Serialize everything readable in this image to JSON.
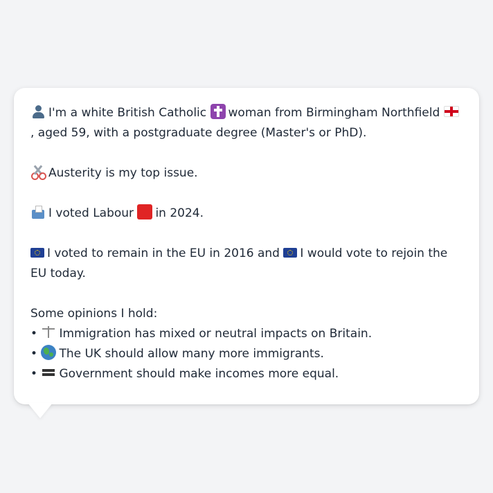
{
  "profile": {
    "intro_a": "I'm a white British Catholic",
    "intro_b": "woman from Birmingham Northfield",
    "intro_c": ", aged 59, with a postgraduate degree (Master's or PhD).",
    "top_issue": "Austerity is my top issue.",
    "vote_a": "I voted Labour",
    "vote_b": "in 2024.",
    "eu_a": "I voted to remain in the EU in 2016 and",
    "eu_b": "I would vote to rejoin the EU today."
  },
  "opinions": {
    "title": "Some opinions I hold:",
    "bullet": "•",
    "items": [
      {
        "icon": "scales-icon",
        "text": "Immigration has mixed or neutral impacts on Britain."
      },
      {
        "icon": "globe-icon",
        "text": "The UK should allow many more immigrants."
      },
      {
        "icon": "equals-icon",
        "text": "Government should make incomes more equal."
      }
    ]
  },
  "colors": {
    "background": "#f3f4f6",
    "bubble": "#ffffff",
    "text": "#1f2937",
    "labour_red": "#e02424"
  }
}
